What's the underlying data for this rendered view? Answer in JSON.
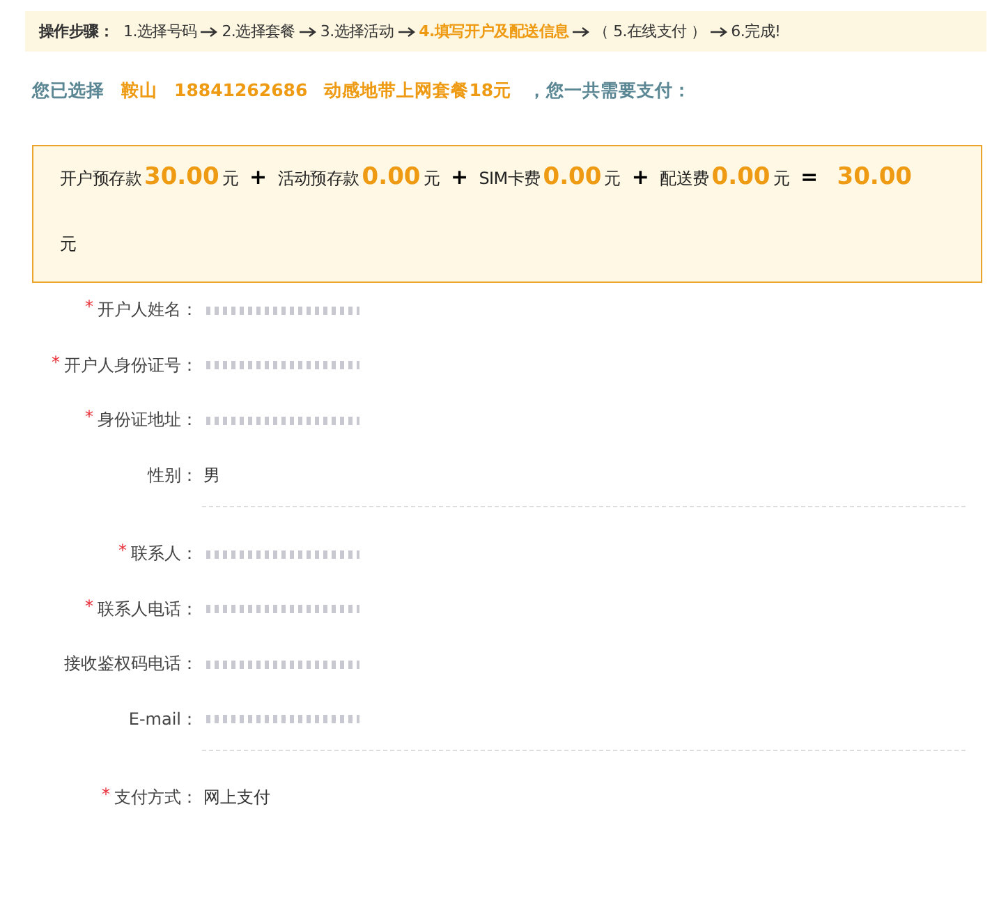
{
  "steps": {
    "title": "操作步骤：",
    "items": [
      {
        "label": "1.选择号码",
        "current": false
      },
      {
        "label": "2.选择套餐",
        "current": false
      },
      {
        "label": "3.选择活动",
        "current": false
      },
      {
        "label": "4.填写开户及配送信息",
        "current": true
      },
      {
        "label": "（ 5.在线支付 ）",
        "current": false
      },
      {
        "label": "6.完成!",
        "current": false
      }
    ]
  },
  "summary": {
    "parts": [
      {
        "text": "您已选择",
        "highlight": false
      },
      {
        "text": "鞍山",
        "highlight": true
      },
      {
        "text": "18841262686",
        "highlight": true
      },
      {
        "text": "动感地带上网套餐18元",
        "highlight": true
      },
      {
        "text": "，您一共需要支付：",
        "highlight": false
      }
    ]
  },
  "cost": {
    "items": [
      {
        "label": "开户预存款",
        "amount": "30.00",
        "unit": "元"
      },
      {
        "label": "活动预存款",
        "amount": "0.00",
        "unit": "元"
      },
      {
        "label": "SIM卡费",
        "amount": "0.00",
        "unit": "元"
      },
      {
        "label": "配送费",
        "amount": "0.00",
        "unit": "元"
      }
    ],
    "plus": "+",
    "equals": "=",
    "total": "30.00",
    "total_unit": "元"
  },
  "groups": [
    {
      "fields": [
        {
          "label": "开户人姓名：",
          "required": true,
          "redacted": true
        },
        {
          "label": "开户人身份证号：",
          "required": true,
          "redacted": true
        },
        {
          "label": "身份证地址：",
          "required": true,
          "redacted": true
        },
        {
          "label": "性别：",
          "required": false,
          "redacted": false,
          "value": "男"
        }
      ]
    },
    {
      "fields": [
        {
          "label": "联系人：",
          "required": true,
          "redacted": true
        },
        {
          "label": "联系人电话：",
          "required": true,
          "redacted": true
        },
        {
          "label": "接收鉴权码电话：",
          "required": false,
          "redacted": true
        },
        {
          "label": "E-mail：",
          "required": false,
          "redacted": true
        }
      ]
    },
    {
      "fields": [
        {
          "label": "支付方式：",
          "required": true,
          "redacted": false,
          "value": "网上支付"
        }
      ]
    }
  ],
  "required_mark": "*"
}
